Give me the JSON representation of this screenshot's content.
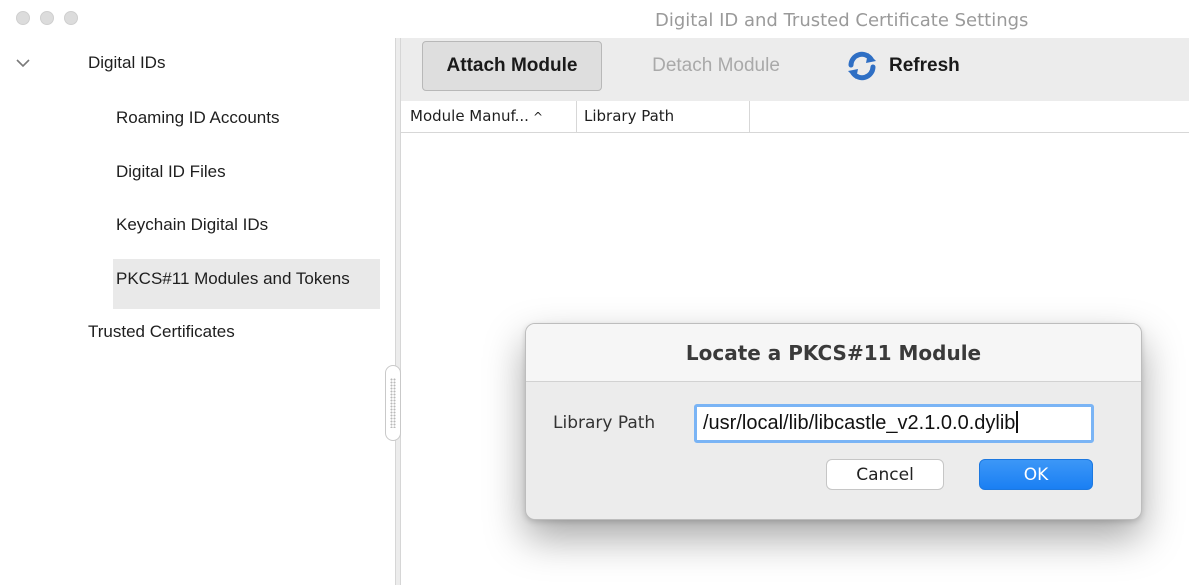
{
  "window": {
    "title": "Digital ID and Trusted Certificate Settings"
  },
  "sidebar": {
    "items": [
      {
        "label": "Digital IDs",
        "level": 0,
        "expanded": true
      },
      {
        "label": "Roaming ID Accounts",
        "level": 1
      },
      {
        "label": "Digital ID Files",
        "level": 1
      },
      {
        "label": "Keychain Digital IDs",
        "level": 1
      },
      {
        "label": "PKCS#11 Modules and Tokens",
        "level": 1,
        "selected": true
      },
      {
        "label": "Trusted Certificates",
        "level": 0
      }
    ]
  },
  "toolbar": {
    "attach_label": "Attach Module",
    "detach_label": "Detach Module",
    "refresh_label": "Refresh",
    "refresh_icon": "refresh-icon"
  },
  "table": {
    "columns": [
      "Module Manuf...",
      "Library Path"
    ],
    "sort_indicator": "^",
    "rows": []
  },
  "dialog": {
    "title": "Locate a PKCS#11 Module",
    "field_label": "Library Path",
    "field_value": "/usr/local/lib/libcastle_v2.1.0.0.dylib",
    "cancel_label": "Cancel",
    "ok_label": "OK"
  },
  "colors": {
    "accent": "#1a7ff3",
    "focus_ring": "#7ab4f5",
    "selection": "#e9e9e9"
  }
}
